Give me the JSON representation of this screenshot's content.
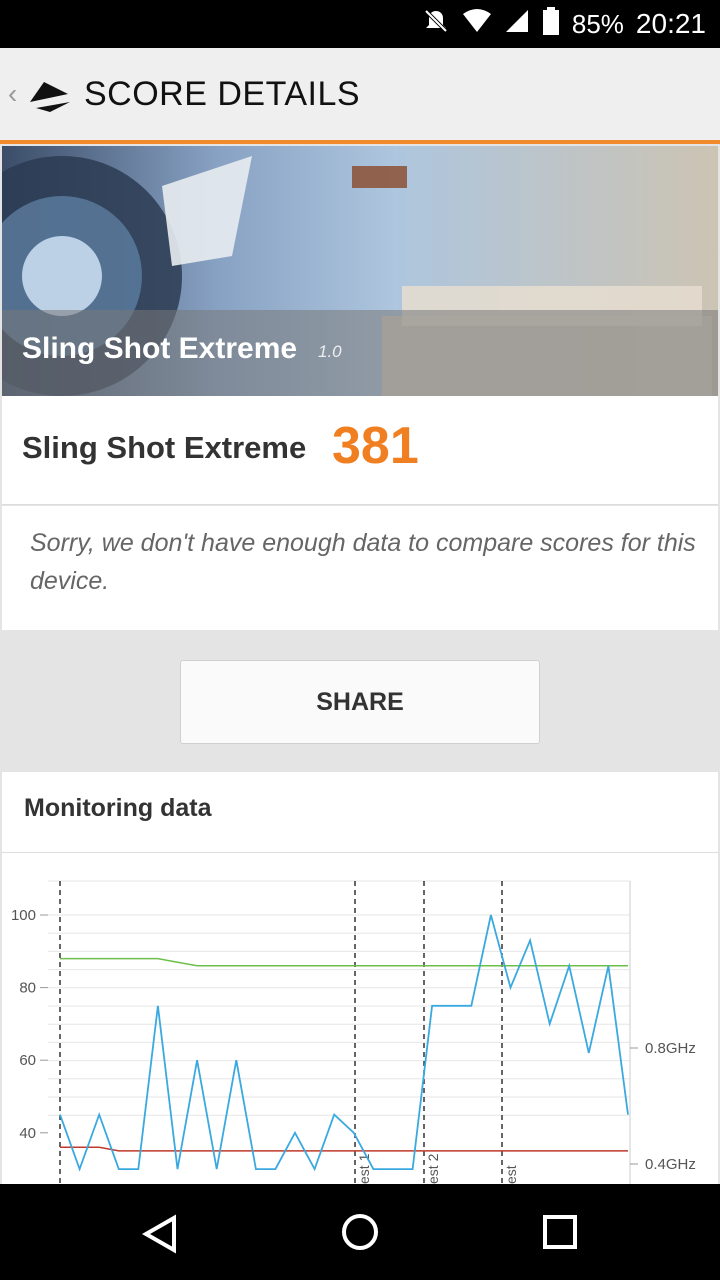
{
  "status": {
    "battery": "85%",
    "time": "20:21"
  },
  "appbar": {
    "title": "SCORE DETAILS"
  },
  "hero": {
    "title": "Sling Shot Extreme",
    "version": "1.0"
  },
  "score": {
    "name": "Sling Shot Extreme",
    "value": "381"
  },
  "message": "Sorry, we don't have enough data to compare scores for this device.",
  "share_label": "SHARE",
  "monitoring": {
    "title": "Monitoring data"
  },
  "chart_data": {
    "type": "line",
    "y_left_ticks": [
      "100",
      "80",
      "60",
      "40"
    ],
    "y_right_ticks": [
      "0.8GHz",
      "0.4GHz"
    ],
    "markers": [
      "est 1",
      "est 2",
      "est"
    ],
    "series": [
      {
        "values": [
          88,
          88,
          88,
          88,
          88,
          88,
          87,
          86,
          86,
          86,
          86,
          86,
          86,
          86,
          86,
          86,
          86,
          86,
          86,
          86,
          86,
          86,
          86,
          86,
          86,
          86,
          86,
          86,
          86,
          86
        ]
      },
      {
        "values": [
          36,
          36,
          36,
          35,
          35,
          35,
          35,
          35,
          35,
          35,
          35,
          35,
          35,
          35,
          35,
          35,
          35,
          35,
          35,
          35,
          35,
          35,
          35,
          35,
          35,
          35,
          35,
          35,
          35,
          35
        ]
      },
      {
        "values": [
          45,
          30,
          45,
          30,
          30,
          75,
          30,
          60,
          30,
          60,
          30,
          30,
          40,
          30,
          45,
          40,
          30,
          30,
          30,
          75,
          75,
          75,
          100,
          80,
          93,
          70,
          86,
          62,
          86,
          45
        ]
      }
    ],
    "colors": {
      "green": "#6cbf4a",
      "red": "#c0392b",
      "blue": "#3aa9e0"
    }
  }
}
